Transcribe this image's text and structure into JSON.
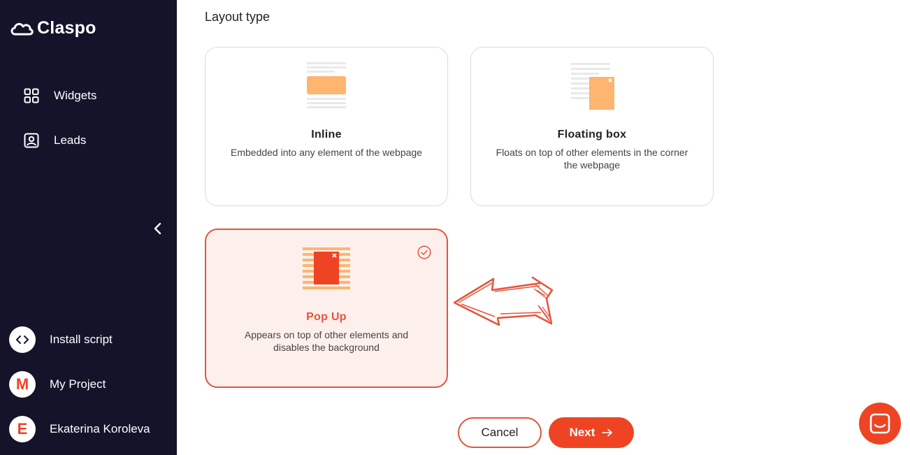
{
  "brand": {
    "name": "Claspo",
    "accent": "#ef4423",
    "sidebar_bg": "#14132a"
  },
  "sidebar": {
    "nav": [
      {
        "label": "Widgets",
        "icon": "grid-icon"
      },
      {
        "label": "Leads",
        "icon": "contact-card-icon"
      }
    ],
    "collapse_icon": "chevron-left-icon",
    "bottom": [
      {
        "label": "Install script",
        "badge": "‹›",
        "icon": "code-icon"
      },
      {
        "label": "My Project",
        "badge": "M"
      },
      {
        "label": "Ekaterina Koroleva",
        "badge": "E"
      }
    ]
  },
  "main": {
    "title": "Layout type",
    "cards": [
      {
        "title": "Inline",
        "desc": "Embedded into any element of the webpage",
        "selected": false
      },
      {
        "title": "Floating box",
        "desc": "Floats on top of other elements in the corner the webpage",
        "selected": false
      },
      {
        "title": "Pop Up",
        "desc": "Appears on top of other elements and disables the background",
        "selected": true
      }
    ]
  },
  "actions": {
    "cancel": "Cancel",
    "next": "Next",
    "next_icon": "arrow-right-icon"
  },
  "chat_icon": "chat-icon"
}
